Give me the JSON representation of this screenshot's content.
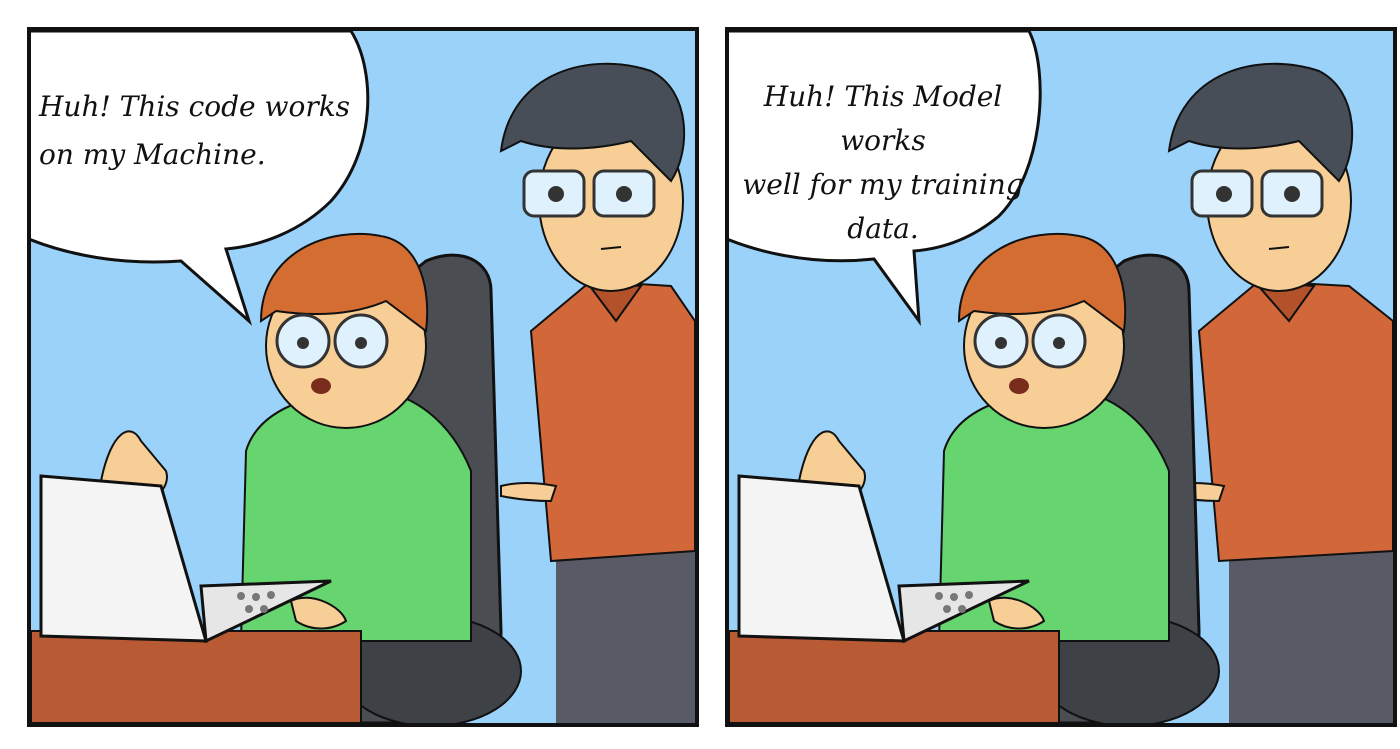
{
  "panels": [
    {
      "speech": "Huh! This code works\non my Machine."
    },
    {
      "speech": "Huh! This Model works\nwell for my training\ndata."
    }
  ],
  "colors": {
    "background": "#9bd2fa",
    "border": "#111111",
    "shirt_green": "#66d46f",
    "shirt_orange": "#d2683a",
    "hair_dark": "#474e58",
    "hair_ginger": "#d46d32",
    "chair": "#4a4d52",
    "desk": "#b85a34",
    "pants": "#585a65",
    "skin": "#f7cf96",
    "laptop": "#f4f4f4"
  },
  "icons": [
    "speech-bubble",
    "laptop",
    "office-chair",
    "desk"
  ]
}
